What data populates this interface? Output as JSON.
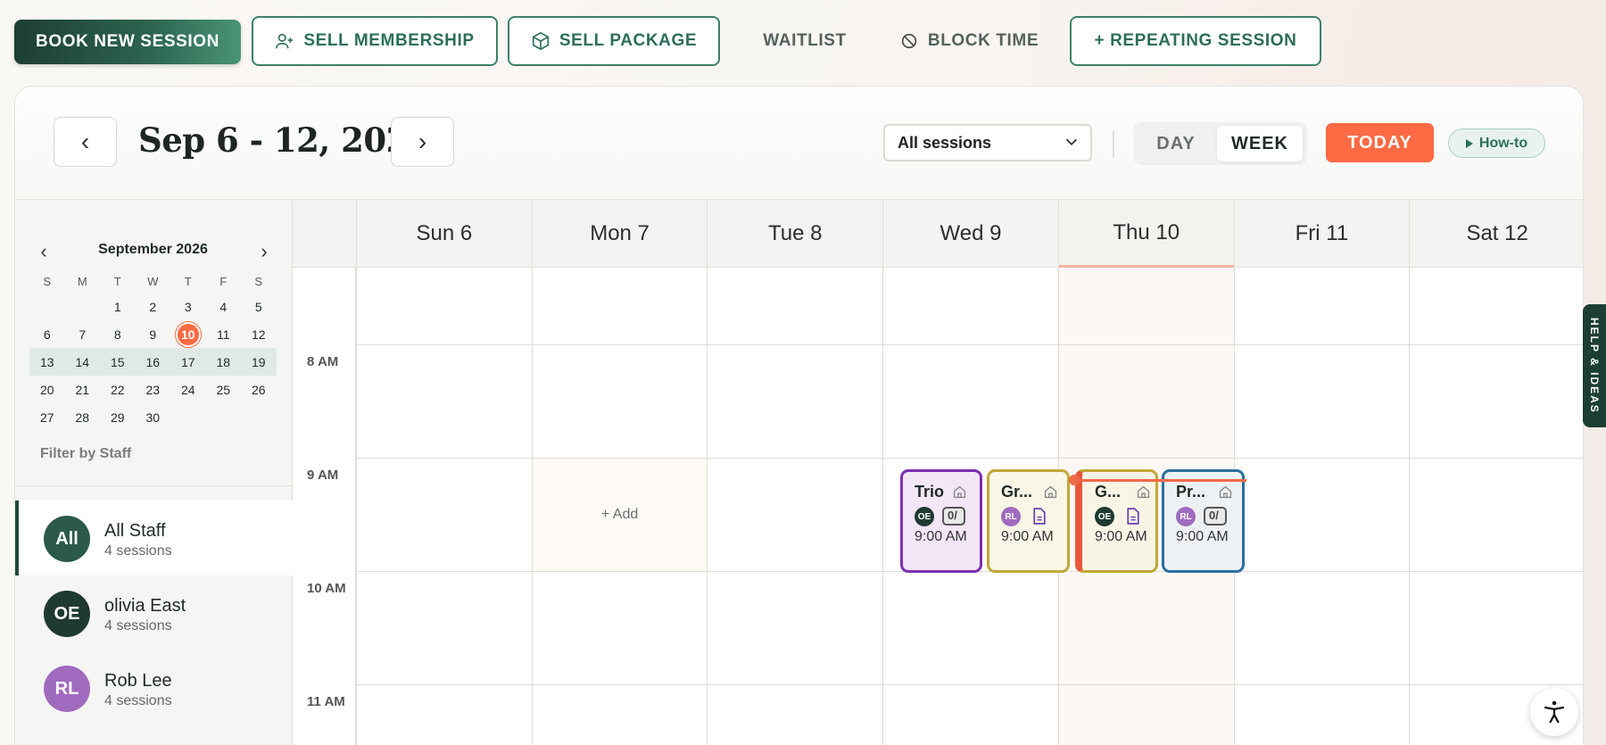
{
  "toolbar": {
    "book_new_session": "BOOK NEW SESSION",
    "sell_membership": "SELL MEMBERSHIP",
    "sell_package": "SELL PACKAGE",
    "waitlist": "WAITLIST",
    "block_time": "BLOCK TIME",
    "repeating_session": "+ REPEATING SESSION"
  },
  "header": {
    "prev": "‹",
    "next": "›",
    "date_range": "Sep 6 - 12, 2026",
    "session_filter": "All sessions",
    "view_day": "DAY",
    "view_week": "WEEK",
    "active_view": "WEEK",
    "today": "TODAY",
    "howto": "How-to"
  },
  "mini_calendar": {
    "title": "September 2026",
    "prev": "‹",
    "next": "›",
    "weekdays": [
      "S",
      "M",
      "T",
      "W",
      "T",
      "F",
      "S"
    ],
    "weeks": [
      [
        "",
        "",
        "1",
        "2",
        "3",
        "4",
        "5"
      ],
      [
        "6",
        "7",
        "8",
        "9",
        "10",
        "11",
        "12"
      ],
      [
        "13",
        "14",
        "15",
        "16",
        "17",
        "18",
        "19"
      ],
      [
        "20",
        "21",
        "22",
        "23",
        "24",
        "25",
        "26"
      ],
      [
        "27",
        "28",
        "29",
        "30",
        "",
        "",
        ""
      ]
    ],
    "selected_week_index": 1,
    "today": "10"
  },
  "staff_filter": {
    "label": "Filter by Staff",
    "items": [
      {
        "initials": "All",
        "name": "All Staff",
        "count": "4 sessions",
        "color": "#2b5a49",
        "active": true
      },
      {
        "initials": "OE",
        "name": "olivia East",
        "count": "4 sessions",
        "color": "#1f3a31",
        "active": false
      },
      {
        "initials": "RL",
        "name": "Rob Lee",
        "count": "4 sessions",
        "color": "#a06bbf",
        "active": false
      }
    ]
  },
  "calendar": {
    "days": [
      "Sun 6",
      "Mon 7",
      "Tue 8",
      "Wed 9",
      "Thu 10",
      "Fri 11",
      "Sat 12"
    ],
    "today_index": 4,
    "times": [
      "8 AM",
      "9 AM",
      "10 AM",
      "11 AM"
    ],
    "add_label": "+ Add",
    "events": [
      {
        "title": "Trio",
        "staff": "OE",
        "chip": "0/",
        "time": "9:00 AM"
      },
      {
        "title": "Gr...",
        "staff": "RL",
        "time": "9:00 AM"
      },
      {
        "title": "G...",
        "staff": "OE",
        "time": "9:00 AM"
      },
      {
        "title": "Pr...",
        "staff": "RL",
        "chip": "0/",
        "time": "9:00 AM"
      }
    ]
  },
  "side_tab": {
    "label": "HELP & IDEAS"
  },
  "colors": {
    "brand": "#1d3e33",
    "accent": "#fd6a43",
    "outline": "#3d8069"
  }
}
